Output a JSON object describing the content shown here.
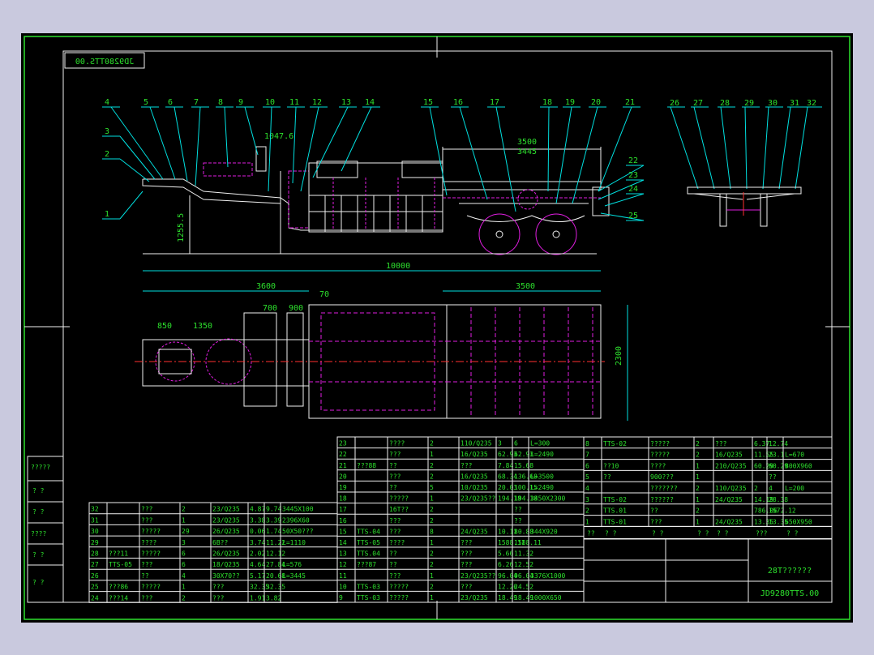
{
  "drawing_number_mirrored": "JD9280TTS.00",
  "drawing_number": "JD9280TTS.00",
  "drawing_title": "28T??????",
  "balloons_side": [
    "1",
    "2",
    "3",
    "4",
    "5",
    "6",
    "7",
    "8",
    "9",
    "10",
    "11",
    "12",
    "13",
    "14",
    "15",
    "16",
    "17",
    "18",
    "19",
    "20",
    "21",
    "22",
    "23",
    "24",
    "25"
  ],
  "balloons_end": [
    "26",
    "27",
    "28",
    "29",
    "30",
    "31",
    "32"
  ],
  "dims": {
    "overall": "10000",
    "left": "3600",
    "right": "3500",
    "d_70": "70",
    "d_700": "700",
    "d_900": "900",
    "d_850": "850",
    "d_1350": "1350",
    "width": "2300",
    "side_top": "1047.6",
    "side_h": "1255.5",
    "deck_top": "3500",
    "deck_inner": "3445"
  },
  "left_sidebar": [
    "?????",
    "? ?",
    "? ?",
    "????",
    "? ?",
    "? ?"
  ],
  "bom_left": [
    [
      "32",
      "",
      "???",
      "2",
      "23/Q235",
      "4.87",
      "9.74",
      "3445X100"
    ],
    [
      "31",
      "",
      "???",
      "1",
      "23/Q235",
      "3.38",
      "3.39",
      "2396X60"
    ],
    [
      "30",
      "",
      "?????",
      "29",
      "26/Q235",
      "0.06",
      "1.74",
      "50X50???"
    ],
    [
      "29",
      "",
      "????",
      "3",
      "6B??",
      "3.74",
      "11.22",
      "L=1110"
    ],
    [
      "28",
      "???11",
      "?????",
      "6",
      "26/Q235",
      "2.02",
      "12.12",
      ""
    ],
    [
      "27",
      "TTS-05",
      "???",
      "6",
      "18/Q235",
      "4.64",
      "27.84",
      "L=576"
    ],
    [
      "26",
      "",
      "??",
      "4",
      "30X70??",
      "5.17",
      "20.68",
      "L=3445"
    ],
    [
      "25",
      "???86",
      "?????",
      "1",
      "???",
      "32.35",
      "32.35",
      ""
    ],
    [
      "24",
      "???14",
      "???",
      "2",
      "???",
      "1.91",
      "3.82",
      ""
    ]
  ],
  "bom_mid": [
    [
      "23",
      "",
      "????",
      "2",
      "110/Q235",
      "3",
      "6",
      "L=300"
    ],
    [
      "22",
      "",
      "???",
      "1",
      "16/Q235",
      "62.93",
      "62.93",
      "L=2490"
    ],
    [
      "21",
      "???88",
      "??",
      "2",
      "???",
      "7.84",
      "15.68",
      ""
    ],
    [
      "20",
      "",
      "???",
      "2",
      "16/Q235",
      "68.34",
      "136.68",
      "L=3500"
    ],
    [
      "19",
      "",
      "??",
      "5",
      "10/Q235",
      "20.03",
      "100.15",
      "L=2490"
    ],
    [
      "18",
      "",
      "?????",
      "1",
      "23/Q235??",
      "194.18",
      "194.18",
      "3450X2300"
    ],
    [
      "17",
      "",
      "16T??",
      "2",
      "",
      "",
      "??",
      ""
    ],
    [
      "16",
      "",
      "???",
      "2",
      "",
      "",
      "??",
      ""
    ],
    [
      "15",
      "TTS-04",
      "???",
      "8",
      "24/Q235",
      "10.11",
      "80.88",
      "344X920"
    ],
    [
      "14",
      "TTS-05",
      "????",
      "1",
      "???",
      "1588.11",
      "1588.11",
      ""
    ],
    [
      "13",
      "TTS.04",
      "??",
      "2",
      "???",
      "5.66",
      "11.32",
      ""
    ],
    [
      "12",
      "???87",
      "??",
      "2",
      "???",
      "6.26",
      "12.52",
      ""
    ],
    [
      "11",
      "",
      "???",
      "1",
      "23/Q235??",
      "96.04",
      "96.04",
      "3376X1000"
    ],
    [
      "10",
      "TTS-03",
      "?????",
      "2",
      "???",
      "12.26",
      "24.52",
      ""
    ],
    [
      "9",
      "TTS-03",
      "?????",
      "1",
      "23/Q235",
      "18.49",
      "18.49",
      "1000X650"
    ]
  ],
  "bom_right": [
    [
      "8",
      "TTS-02",
      "?????",
      "2",
      "???",
      "6.37",
      "12.74",
      ""
    ],
    [
      "7",
      "",
      "?????",
      "2",
      "16/Q235",
      "11.55",
      "23.1",
      "L=670"
    ],
    [
      "6",
      "??10",
      "????",
      "1",
      "210/Q235",
      "60.29",
      "60.29",
      "800X960"
    ],
    [
      "5",
      "??",
      "900???",
      "1",
      "",
      "",
      "??",
      ""
    ],
    [
      "4",
      "",
      "???????",
      "2",
      "110/Q235",
      "2",
      "4",
      "L=200"
    ],
    [
      "3",
      "TTS-02",
      "??????",
      "1",
      "24/Q235",
      "14.19",
      "28.38",
      ""
    ],
    [
      "2",
      "TTS.01",
      "??",
      "2",
      "",
      "786.06",
      "1572.12",
      ""
    ],
    [
      "1",
      "TTS-01",
      "???",
      "1",
      "24/Q235",
      "13.35",
      "13.35",
      "650X950"
    ]
  ],
  "bom_right_header": [
    "??",
    "? ?",
    "? ?",
    "? ?",
    "? ?",
    "???",
    "? ?"
  ],
  "colors": {
    "frame": "#2de02d",
    "cyan": "#00e0e0",
    "magenta": "#e01ee0",
    "white": "#f0f0f0",
    "yellow": "#f0f000",
    "red": "#ff3030",
    "bg": "#000000"
  }
}
